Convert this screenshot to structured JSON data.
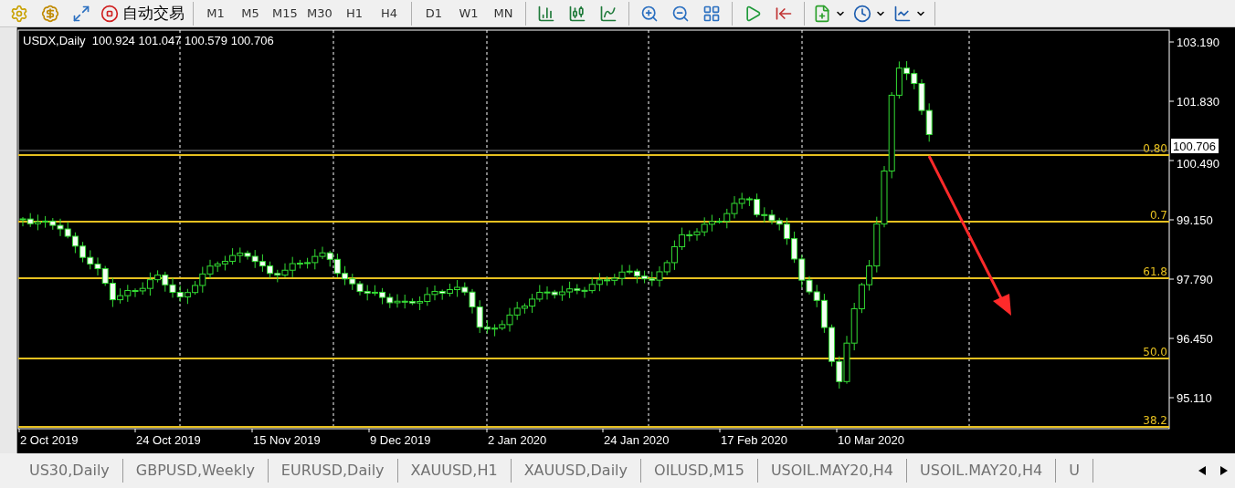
{
  "toolbar": {
    "auto_trading": {
      "label": "自动交易"
    },
    "timeframe_groups": [
      [
        "M1",
        "M5",
        "M15",
        "M30",
        "H1",
        "H4"
      ],
      [
        "D1",
        "W1",
        "MN"
      ]
    ]
  },
  "chart": {
    "title": "USDX,Daily",
    "ohlc": "100.924 101.047 100.579 100.706",
    "price_labels": [
      "103.190",
      "101.830",
      "100.490",
      "99.150",
      "97.790",
      "96.450",
      "95.110"
    ],
    "current_price": "100.706",
    "fib_levels": [
      {
        "label": "0.80"
      },
      {
        "label": "0.7"
      },
      {
        "label": "61.8"
      },
      {
        "label": "50.0"
      },
      {
        "label": "38.2"
      }
    ],
    "date_labels": [
      "2 Oct 2019",
      "24 Oct 2019",
      "15 Nov 2019",
      "9 Dec 2019",
      "2 Jan 2020",
      "24 Jan 2020",
      "17 Feb 2020",
      "10 Mar 2020"
    ]
  },
  "tabs": [
    {
      "label": "US30,Daily"
    },
    {
      "label": "GBPUSD,Weekly"
    },
    {
      "label": "EURUSD,Daily"
    },
    {
      "label": "XAUUSD,H1"
    },
    {
      "label": "XAUUSD,Daily"
    },
    {
      "label": "OILUSD,M15"
    },
    {
      "label": "USOIL.MAY20,H4"
    },
    {
      "label": "USOIL.MAY20,H4"
    },
    {
      "label": "U"
    }
  ]
}
